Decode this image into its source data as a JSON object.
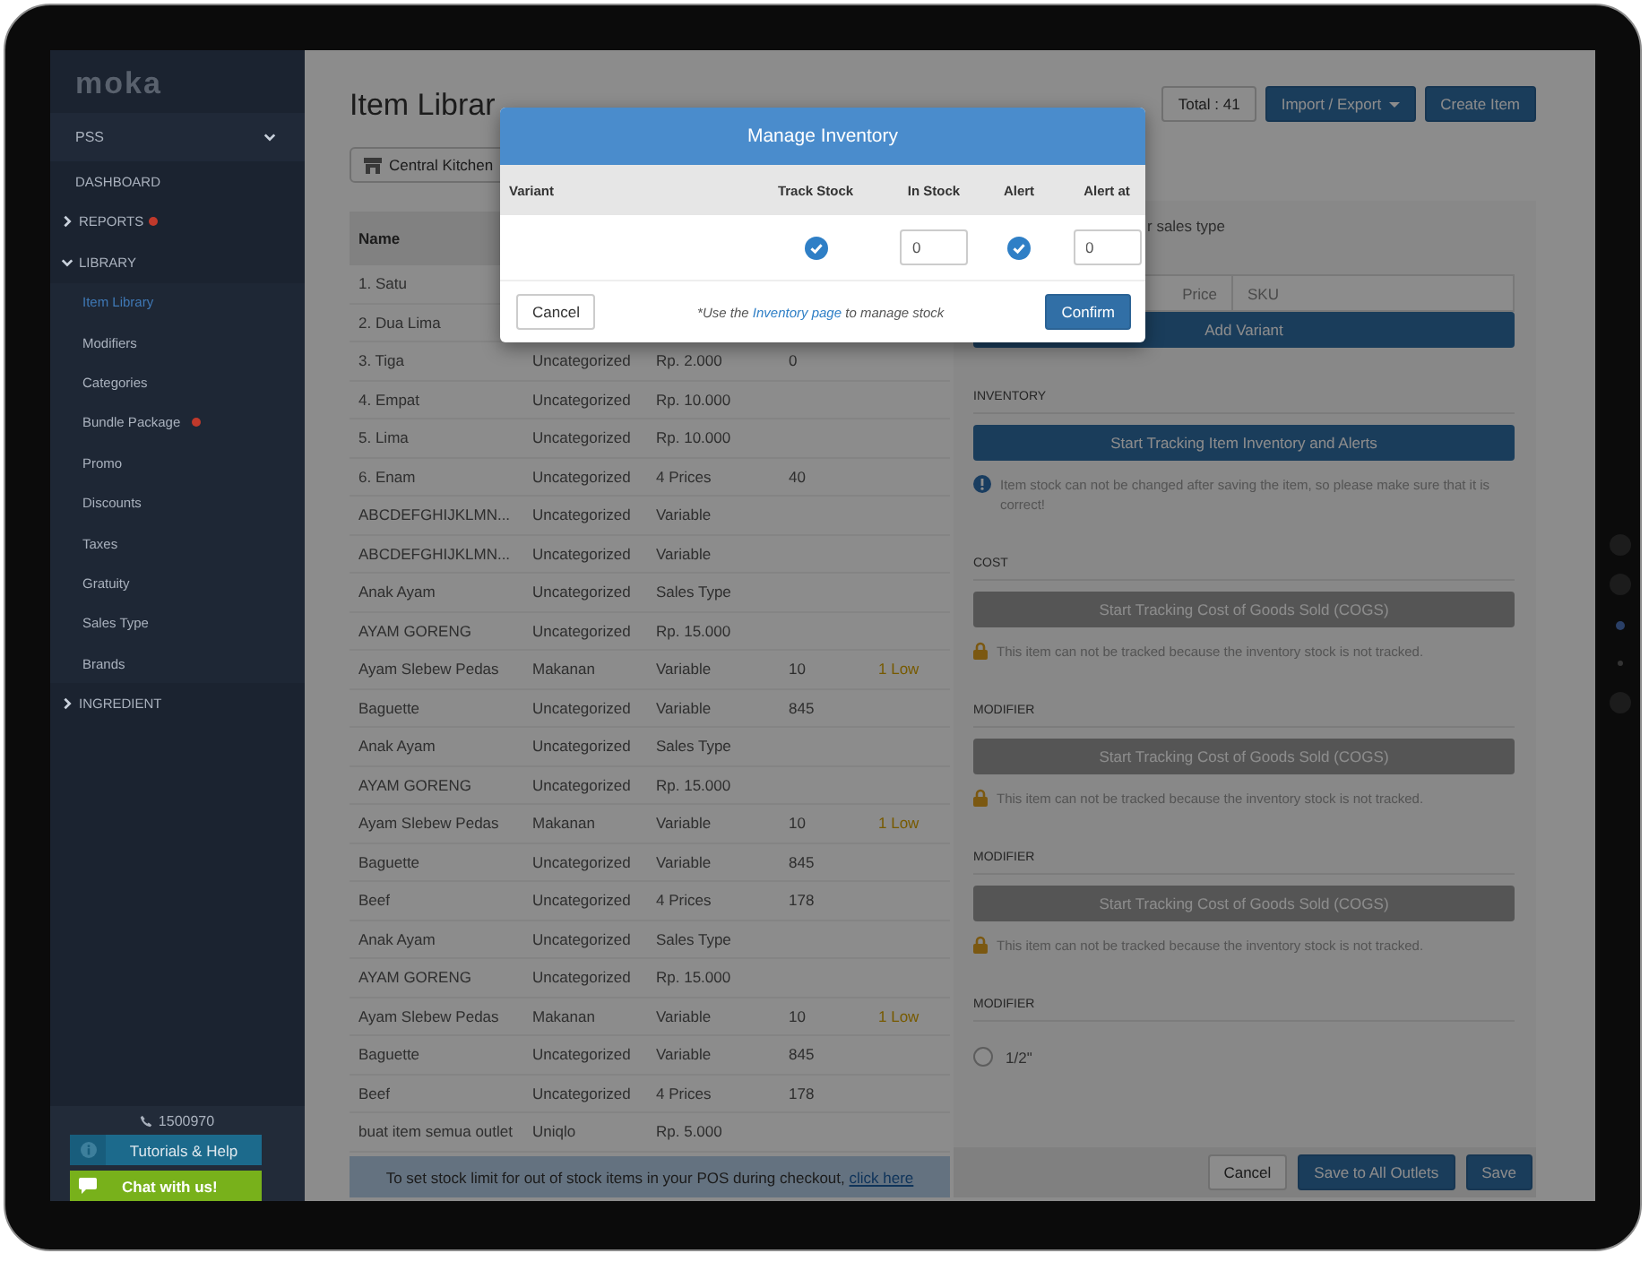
{
  "sidebar": {
    "logo": "moka",
    "outlet_selector": {
      "label": "PSS"
    },
    "items": [
      {
        "label": "DASHBOARD",
        "kind": "link",
        "alert": false
      },
      {
        "label": "REPORTS",
        "kind": "group",
        "expanded": false,
        "alert": true
      },
      {
        "label": "LIBRARY",
        "kind": "group",
        "expanded": true,
        "alert": false,
        "children": [
          {
            "label": "Item Library",
            "selected": true,
            "alert": false
          },
          {
            "label": "Modifiers",
            "selected": false,
            "alert": false
          },
          {
            "label": "Categories",
            "selected": false,
            "alert": false
          },
          {
            "label": "Bundle Package",
            "selected": false,
            "alert": true
          },
          {
            "label": "Promo",
            "selected": false,
            "alert": false
          },
          {
            "label": "Discounts",
            "selected": false,
            "alert": false
          },
          {
            "label": "Taxes",
            "selected": false,
            "alert": false
          },
          {
            "label": "Gratuity",
            "selected": false,
            "alert": false
          },
          {
            "label": "Sales Type",
            "selected": false,
            "alert": false
          },
          {
            "label": "Brands",
            "selected": false,
            "alert": false
          }
        ]
      },
      {
        "label": "INGREDIENT",
        "kind": "group",
        "expanded": false,
        "alert": false
      }
    ],
    "phone": "1500970",
    "help_button": "Tutorials & Help",
    "chat_button": "Chat with us!"
  },
  "header": {
    "title": "Item Librar",
    "total": "Total : 41",
    "import_export": "Import / Export",
    "create_item": "Create Item"
  },
  "outlet_button": "Central Kitchen",
  "table": {
    "columns": [
      "Name"
    ],
    "rows": [
      {
        "name": "1. Satu"
      },
      {
        "name": "2. Dua Lima"
      },
      {
        "name": "3. Tiga",
        "category": "Uncategorized",
        "price": "Rp. 2.000",
        "stock": "0"
      },
      {
        "name": "4. Empat",
        "category": "Uncategorized",
        "price": "Rp. 10.000"
      },
      {
        "name": "5. Lima",
        "category": "Uncategorized",
        "price": "Rp. 10.000"
      },
      {
        "name": "6. Enam",
        "category": "Uncategorized",
        "price": "4 Prices",
        "stock": "40"
      },
      {
        "name": "ABCDEFGHIJKLMN...",
        "category": "Uncategorized",
        "price": "Variable"
      },
      {
        "name": "ABCDEFGHIJKLMN...",
        "category": "Uncategorized",
        "price": "Variable"
      },
      {
        "name": "Anak Ayam",
        "category": "Uncategorized",
        "price": "Sales Type"
      },
      {
        "name": "AYAM GORENG",
        "category": "Uncategorized",
        "price": "Rp. 15.000"
      },
      {
        "name": "Ayam Slebew Pedas",
        "category": "Makanan",
        "price": "Variable",
        "stock": "10",
        "alert": "1 Low"
      },
      {
        "name": "Baguette",
        "category": "Uncategorized",
        "price": "Variable",
        "stock": "845"
      },
      {
        "name": "Anak Ayam",
        "category": "Uncategorized",
        "price": "Sales Type"
      },
      {
        "name": "AYAM GORENG",
        "category": "Uncategorized",
        "price": "Rp. 15.000"
      },
      {
        "name": "Ayam Slebew Pedas",
        "category": "Makanan",
        "price": "Variable",
        "stock": "10",
        "alert": "1 Low"
      },
      {
        "name": "Baguette",
        "category": "Uncategorized",
        "price": "Variable",
        "stock": "845"
      },
      {
        "name": "Beef",
        "category": "Uncategorized",
        "price": "4 Prices",
        "stock": "178"
      },
      {
        "name": "Anak Ayam",
        "category": "Uncategorized",
        "price": "Sales Type"
      },
      {
        "name": "AYAM GORENG",
        "category": "Uncategorized",
        "price": "Rp. 15.000"
      },
      {
        "name": "Ayam Slebew Pedas",
        "category": "Makanan",
        "price": "Variable",
        "stock": "10",
        "alert": "1 Low"
      },
      {
        "name": "Baguette",
        "category": "Uncategorized",
        "price": "Variable",
        "stock": "845"
      },
      {
        "name": "Beef",
        "category": "Uncategorized",
        "price": "4 Prices",
        "stock": "178"
      },
      {
        "name": "buat item semua outlet",
        "category": "Uniqlo",
        "price": "Rp. 5.000"
      }
    ]
  },
  "banner": {
    "text": "To set stock limit for out of stock items in your POS during checkout, ",
    "link": "click here"
  },
  "item_panel": {
    "partial_label": "r sales type",
    "variant_columns": [
      "Price",
      "SKU"
    ],
    "add_variant": "Add Variant",
    "sections": [
      {
        "kind": "inventory",
        "title": "INVENTORY",
        "button": "Start Tracking Item Inventory and Alerts",
        "disabled": false,
        "note": "Item stock can not be changed after saving the item, so please make sure that it is correct!"
      },
      {
        "kind": "cost",
        "title": "COST",
        "button": "Start Tracking Cost of Goods Sold (COGS)",
        "disabled": true,
        "note": "This item can not be tracked because the inventory stock is not tracked."
      },
      {
        "kind": "cost",
        "title": "MODIFIER",
        "button": "Start Tracking Cost of Goods Sold (COGS)",
        "disabled": true,
        "note": "This item can not be tracked because the inventory stock is not tracked."
      },
      {
        "kind": "cost",
        "title": "MODIFIER",
        "button": "Start Tracking Cost of Goods Sold (COGS)",
        "disabled": true,
        "note": "This item can not be tracked because the inventory stock is not tracked."
      },
      {
        "kind": "options",
        "title": "MODIFIER",
        "options": [
          {
            "label": "1/2\"",
            "selected": false
          }
        ]
      }
    ],
    "footer": {
      "cancel": "Cancel",
      "save_all": "Save to All Outlets",
      "save": "Save"
    }
  },
  "modal": {
    "title": "Manage Inventory",
    "columns": [
      "Variant",
      "Track Stock",
      "In Stock",
      "Alert",
      "Alert at"
    ],
    "rows": [
      {
        "track_stock": true,
        "in_stock": "0",
        "alert": true,
        "alert_at": "0"
      }
    ],
    "cancel": "Cancel",
    "note_before": "*Use the ",
    "note_link": "Inventory page",
    "note_after": " to manage stock",
    "confirm": "Confirm"
  }
}
